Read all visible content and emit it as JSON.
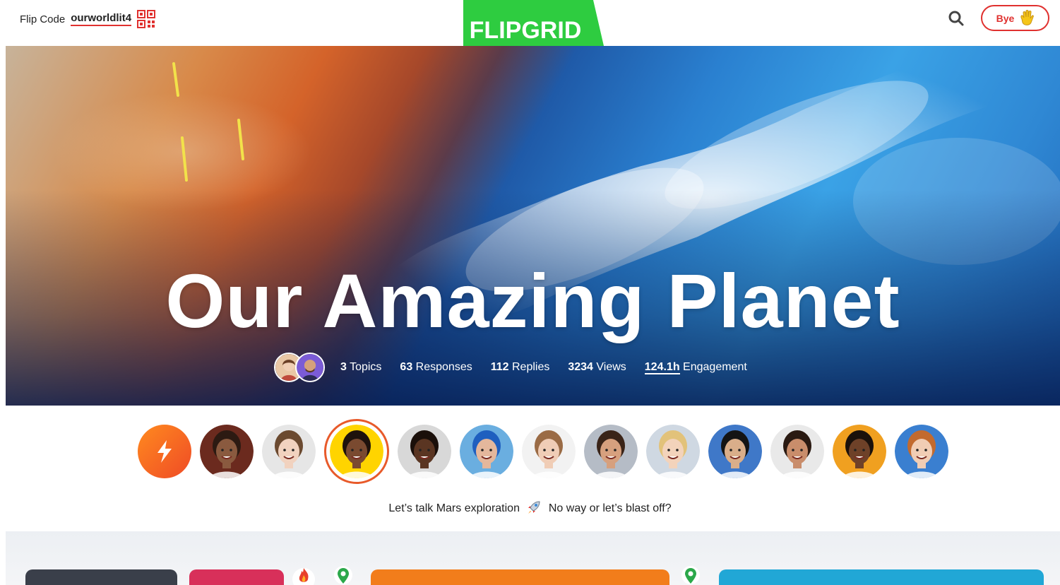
{
  "header": {
    "flip_code_label": "Flip Code",
    "flip_code": "ourworldlit4",
    "logo_text": "FLIPGRID",
    "bye_label": "Bye",
    "icons": [
      "qr-code-icon",
      "search-icon",
      "waving-hand-icon"
    ]
  },
  "hero": {
    "title": "Our Amazing Planet",
    "stats": {
      "topics": {
        "value": "3",
        "label": "Topics"
      },
      "responses": {
        "value": "63",
        "label": "Responses"
      },
      "replies": {
        "value": "112",
        "label": "Replies"
      },
      "views": {
        "value": "3234",
        "label": "Views"
      },
      "engagement": {
        "value": "124.1h",
        "label": "Engagement"
      }
    }
  },
  "responses": {
    "caption_before": "Let’s talk Mars exploration",
    "caption_after": "No way or let’s blast off?",
    "circles": [
      {
        "type": "icon",
        "icon": "lightning-bolt-icon"
      },
      {
        "type": "avatar",
        "skin": "#8a5a3f",
        "hair": "#2c1a12",
        "bg": "#6b2a1e"
      },
      {
        "type": "avatar",
        "skin": "#f1d2bf",
        "hair": "#6b4a30",
        "bg": "#e6e6e6"
      },
      {
        "type": "avatar",
        "skin": "#7a4a30",
        "hair": "#1e120c",
        "bg": "#ffd400",
        "active": true
      },
      {
        "type": "avatar",
        "skin": "#5a3522",
        "hair": "#1a0f0a",
        "bg": "#d8d8d8"
      },
      {
        "type": "avatar",
        "skin": "#e4b79c",
        "hair": "#1f5fbf",
        "bg": "#6aaee0"
      },
      {
        "type": "avatar",
        "skin": "#f0cdb6",
        "hair": "#9a6b45",
        "bg": "#f2f2f2"
      },
      {
        "type": "avatar",
        "skin": "#d6a07e",
        "hair": "#3a2418",
        "bg": "#b5bcc6"
      },
      {
        "type": "avatar",
        "skin": "#f3d3bb",
        "hair": "#e2c27a",
        "bg": "#cfd8e2"
      },
      {
        "type": "avatar",
        "skin": "#d9ae8a",
        "hair": "#141414",
        "bg": "#3f78c8"
      },
      {
        "type": "avatar",
        "skin": "#c98d6b",
        "hair": "#2a1a12",
        "bg": "#e9e9e9"
      },
      {
        "type": "avatar",
        "skin": "#6e4128",
        "hair": "#1b110b",
        "bg": "#f0a020"
      },
      {
        "type": "avatar",
        "skin": "#f1cdb4",
        "hair": "#c26a2e",
        "bg": "#3a7fd0"
      }
    ]
  },
  "colors": {
    "brand_green": "#2ecc40",
    "accent_red": "#e0312f",
    "accent_orange": "#e85a2a"
  }
}
